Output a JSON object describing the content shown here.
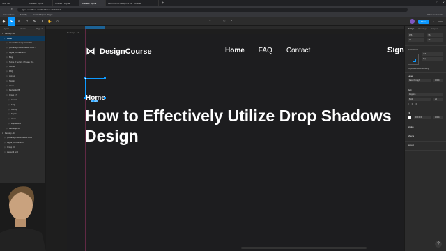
{
  "browser": {
    "tabs": [
      "New Tab",
      "Untitled - Figma",
      "Untitled - Figma",
      "Untitled - Figma",
      "Learn UI/UX Design w/ DesignCo",
      "Untitled"
    ],
    "active_tab": 3,
    "url": "figma.com/file/…/Untitled?node-id=1%3A1",
    "bookmarks": [
      "Screenshots",
      "Sell Pty",
      "Untitled Figma Plugin..."
    ],
    "bookmarks_right": "Other bookmarks"
  },
  "toolbar": {
    "share_label": "Share",
    "zoom_label": "100%"
  },
  "layers_panel": {
    "tab_layers": "Layers",
    "tab_assets": "Assets",
    "page_label": "Page 1",
    "items": [
      "Desktop - 12",
      "Home",
      "How to Effectively Utilize Dro...",
      "pet-savage-hellkin-render-Pixar...",
      "Digital journaler Icon",
      "Blog",
      "Terms of Service / Privacy Po...",
      "Contact",
      "FAQ",
      "Join up",
      "Sign in",
      "Home",
      "Rectangle 88",
      "Group 17",
      "Contact",
      "FAQ",
      "Join up",
      "Sign in",
      "Home",
      "logo-white 1",
      "Rectangle 95",
      "Desktop - 13",
      "pet-savage-hellkin-render-Pixar",
      "Digital journaler Icon",
      "Group 16",
      "Layout & Grid"
    ],
    "selected_index": 1
  },
  "right_panel": {
    "tabs": [
      "Design",
      "Prototype",
      "Inspect"
    ],
    "x": "176",
    "y": "96",
    "w": "44",
    "h": "26",
    "constraints_title": "Constraints",
    "constraint_h": "Left",
    "constraint_v": "Top",
    "fix_scroll": "Fix position when scrolling",
    "layer_title": "Layer",
    "blend": "Pass through",
    "opacity": "100%",
    "text_title": "Text",
    "font": "Poppins",
    "weight": "Bold",
    "size": "24",
    "fill_title": "Fill",
    "fill_hex": "FFFFFF",
    "fill_opacity": "100%",
    "sections": [
      "Stroke",
      "Effects",
      "Export"
    ]
  },
  "canvas": {
    "frame_label": "Desktop - 12",
    "size_badge": "44 × 26",
    "logo_text": "DesignCourse",
    "logo_mark": "DC",
    "nav": [
      "Home",
      "FAQ",
      "Contact"
    ],
    "signin": "Sign in",
    "home_label": "Home",
    "headline_1": "How to Effectively Utilize Drop Shadows",
    "headline_2": "Design"
  }
}
